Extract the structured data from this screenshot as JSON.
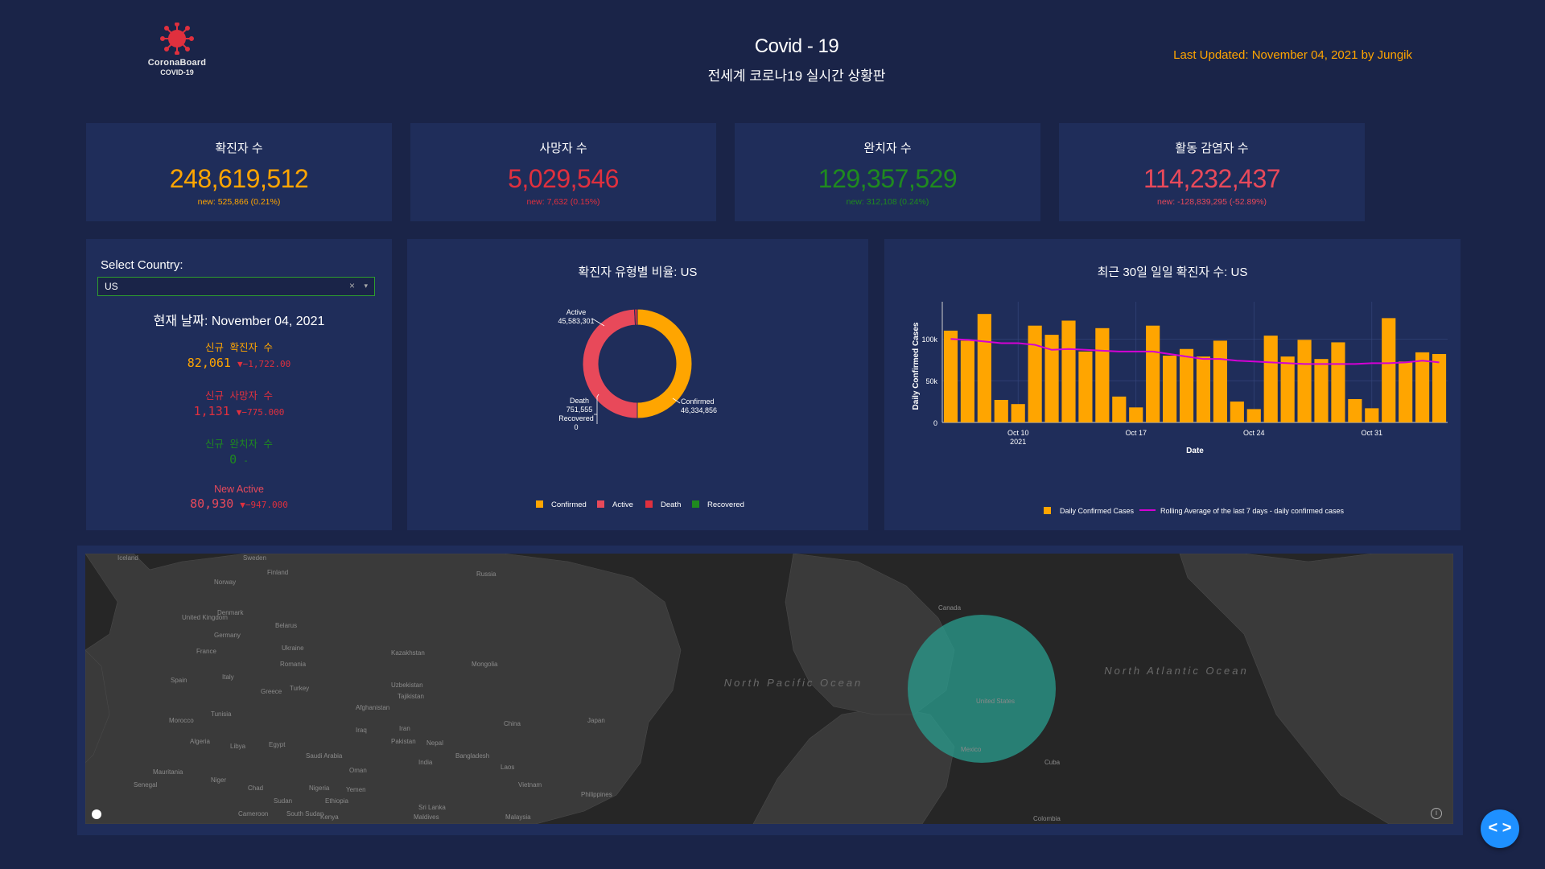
{
  "header": {
    "logo_brand": "CoronaBoard",
    "logo_sub": "COVID-19",
    "title": "Covid - 19",
    "subtitle": "전세계 코로나19 실시간 상황판",
    "updated": "Last Updated: November 04, 2021 by Jungik"
  },
  "kpis": [
    {
      "label": "확진자 수",
      "value": "248,619,512",
      "new": "new: 525,866 (0.21%)",
      "color": "#ffa500"
    },
    {
      "label": "사망자 수",
      "value": "5,029,546",
      "new": "new: 7,632 (0.15%)",
      "color": "#e0303e"
    },
    {
      "label": "완치자 수",
      "value": "129,357,529",
      "new": "new: 312,108 (0.24%)",
      "color": "#1f8a1f"
    },
    {
      "label": "활동 감염자 수",
      "value": "114,232,437",
      "new": "new: -128,839,295 (-52.89%)",
      "color": "#e8495a"
    }
  ],
  "selector": {
    "label": "Select Country:",
    "value": "US",
    "clear": "×",
    "arrow": "▾",
    "current_date": "현재 날짜: November 04, 2021"
  },
  "country_stats": [
    {
      "label": "신규 확진자 수",
      "value": "82,061",
      "delta": "▼−1,722.00",
      "color": "#ffa500"
    },
    {
      "label": "신규 사망자 수",
      "value": "1,131",
      "delta": "▼−775.000",
      "color": "#e0303e"
    },
    {
      "label": "신규 완치자 수",
      "value": "0",
      "delta": "-",
      "color": "#1f8a1f"
    },
    {
      "label": "New Active",
      "value": "80,930",
      "delta": "▼−947.000",
      "color": "#e8495a"
    }
  ],
  "donut": {
    "title": "확진자 유형별 비율: US",
    "labels": {
      "active": "Active",
      "active_value": "45,583,301",
      "death": "Death",
      "death_value": "751,555",
      "recovered": "Recovered",
      "recovered_value": "0",
      "confirmed": "Confirmed",
      "confirmed_value": "46,334,856"
    },
    "legend": [
      "Confirmed",
      "Active",
      "Death",
      "Recovered"
    ],
    "colors": {
      "Confirmed": "#ffa500",
      "Active": "#e8495a",
      "Death": "#e0303e",
      "Recovered": "#1f8a1f"
    }
  },
  "bar_chart": {
    "title": "최근 30일 일일 확진자 수: US",
    "ylabel": "Daily Confirmed Cases",
    "xlabel": "Date",
    "yticks": [
      "0",
      "50k",
      "100k"
    ],
    "xticks": [
      "Oct 10",
      "Oct 17",
      "Oct 24",
      "Oct 31"
    ],
    "xticks_sub": "2021",
    "legend_bar": "Daily Confirmed Cases",
    "legend_line": "Rolling Average of the last 7 days - daily confirmed cases"
  },
  "map": {
    "labels": [
      "Iceland",
      "Sweden",
      "Finland",
      "Norway",
      "United Kingdom",
      "Denmark",
      "Belarus",
      "Germany",
      "Ukraine",
      "France",
      "Romania",
      "Italy",
      "Spain",
      "Turkey",
      "Greece",
      "Kazakhstan",
      "Mongolia",
      "Russia",
      "Uzbekistan",
      "Tajikistan",
      "Afghanistan",
      "Iraq",
      "Iran",
      "Pakistan",
      "China",
      "Japan",
      "Nepal",
      "India",
      "Bangladesh",
      "Laos",
      "Vietnam",
      "Philippines",
      "Sri Lanka",
      "Malaysia",
      "Maldives",
      "Tunisia",
      "Morocco",
      "Algeria",
      "Libya",
      "Egypt",
      "Saudi Arabia",
      "Oman",
      "Yemen",
      "Mauritania",
      "Niger",
      "Chad",
      "Sudan",
      "Senegal",
      "Nigeria",
      "Ethiopia",
      "South Sudan",
      "Cameroon",
      "Kenya",
      "Canada",
      "United States",
      "Mexico",
      "Cuba",
      "Colombia",
      "North Pacific Ocean",
      "North Atlantic Ocean"
    ],
    "colors": {
      "land": "#3a3a3a",
      "water": "#262626",
      "bubble": "#2a9d8f"
    }
  },
  "chart_data": [
    {
      "type": "pie",
      "title": "확진자 유형별 비율: US",
      "categories": [
        "Confirmed",
        "Active",
        "Death",
        "Recovered"
      ],
      "values": [
        46334856,
        45583301,
        751555,
        0
      ]
    },
    {
      "type": "bar",
      "title": "최근 30일 일일 확진자 수: US",
      "xlabel": "Date",
      "ylabel": "Daily Confirmed Cases",
      "ylim": [
        0,
        135000
      ],
      "x": [
        "2021-10-06",
        "2021-10-07",
        "2021-10-08",
        "2021-10-09",
        "2021-10-10",
        "2021-10-11",
        "2021-10-12",
        "2021-10-13",
        "2021-10-14",
        "2021-10-15",
        "2021-10-16",
        "2021-10-17",
        "2021-10-18",
        "2021-10-19",
        "2021-10-20",
        "2021-10-21",
        "2021-10-22",
        "2021-10-23",
        "2021-10-24",
        "2021-10-25",
        "2021-10-26",
        "2021-10-27",
        "2021-10-28",
        "2021-10-29",
        "2021-10-30",
        "2021-10-31",
        "2021-11-01",
        "2021-11-02",
        "2021-11-03",
        "2021-11-04"
      ],
      "series": [
        {
          "name": "Daily Confirmed Cases",
          "values": [
            110000,
            98000,
            130000,
            27000,
            22000,
            116000,
            105000,
            122000,
            85000,
            113000,
            31000,
            18000,
            116000,
            80000,
            88000,
            79000,
            98000,
            25000,
            16000,
            104000,
            79000,
            99000,
            76000,
            96000,
            28000,
            17000,
            125000,
            73000,
            84000,
            82000
          ]
        },
        {
          "name": "Rolling Average of the last 7 days - daily confirmed cases",
          "values": [
            100000,
            99000,
            97000,
            95000,
            95000,
            93000,
            87000,
            88000,
            87000,
            86000,
            85000,
            85000,
            85000,
            82000,
            79000,
            76000,
            76000,
            74000,
            73000,
            72000,
            71000,
            70000,
            70000,
            70000,
            70000,
            71000,
            71000,
            72000,
            74000,
            72000
          ]
        }
      ]
    }
  ]
}
